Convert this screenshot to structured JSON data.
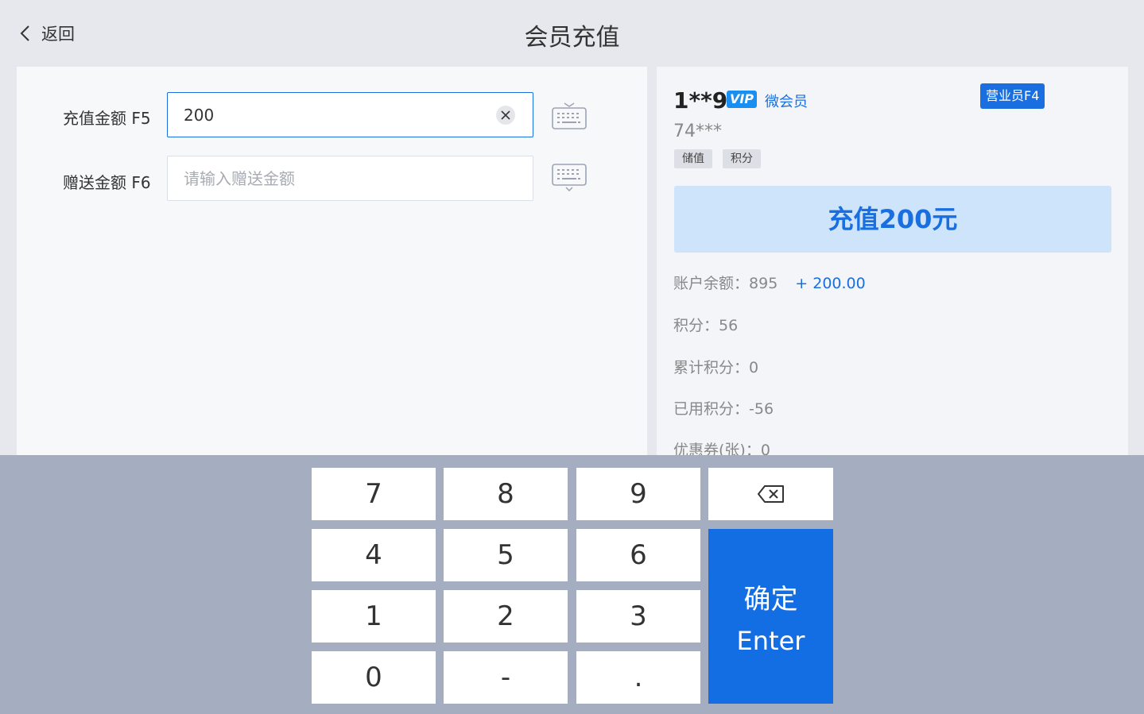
{
  "header": {
    "back_label": "返回",
    "title": "会员充值"
  },
  "form": {
    "recharge_label": "充值金额 F5",
    "recharge_value": "200",
    "gift_label": "赠送金额 F6",
    "gift_placeholder": "请输入赠送金额"
  },
  "member": {
    "name": "1**9",
    "vip_badge": "VIP",
    "type": "微会员",
    "staff_badge": "营业员F4",
    "phone": "74***",
    "tags": [
      "储值",
      "积分"
    ],
    "recharge_banner": "充值200元",
    "balance_label": "账户余额：",
    "balance_value": "895",
    "balance_plus": "+ 200.00",
    "points_label": "积分：",
    "points_value": "56",
    "total_points_label": "累计积分：",
    "total_points_value": "0",
    "used_points_label": "已用积分：",
    "used_points_value": "-56",
    "coupons_label": "优惠券(张)：",
    "coupons_value": "0"
  },
  "keypad": {
    "keys": [
      "7",
      "8",
      "9",
      "4",
      "5",
      "6",
      "1",
      "2",
      "3",
      "0",
      "-",
      "."
    ],
    "enter_cn": "确定",
    "enter_en": "Enter"
  },
  "colors": {
    "accent": "#1a6fe0",
    "banner_bg": "#cde4fa",
    "keypad_bg": "#a5aec0",
    "enter_bg": "#146ee3"
  }
}
